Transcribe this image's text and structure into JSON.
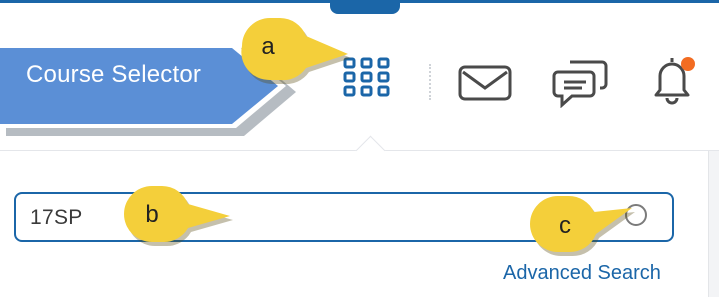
{
  "header": {
    "course_selector_label": "Course Selector",
    "icons": [
      "grid-waffle-icon",
      "mail-icon",
      "chat-icon",
      "bell-icon"
    ],
    "notification_dot_color": "#f26c22"
  },
  "search": {
    "value": "17SP",
    "advanced_label": "Advanced Search"
  },
  "markers": {
    "a": "a",
    "b": "b",
    "c": "c"
  },
  "colors": {
    "accent": "#1b66a8",
    "callout": "#5b8fd6",
    "marker": "#f4cf3a"
  }
}
